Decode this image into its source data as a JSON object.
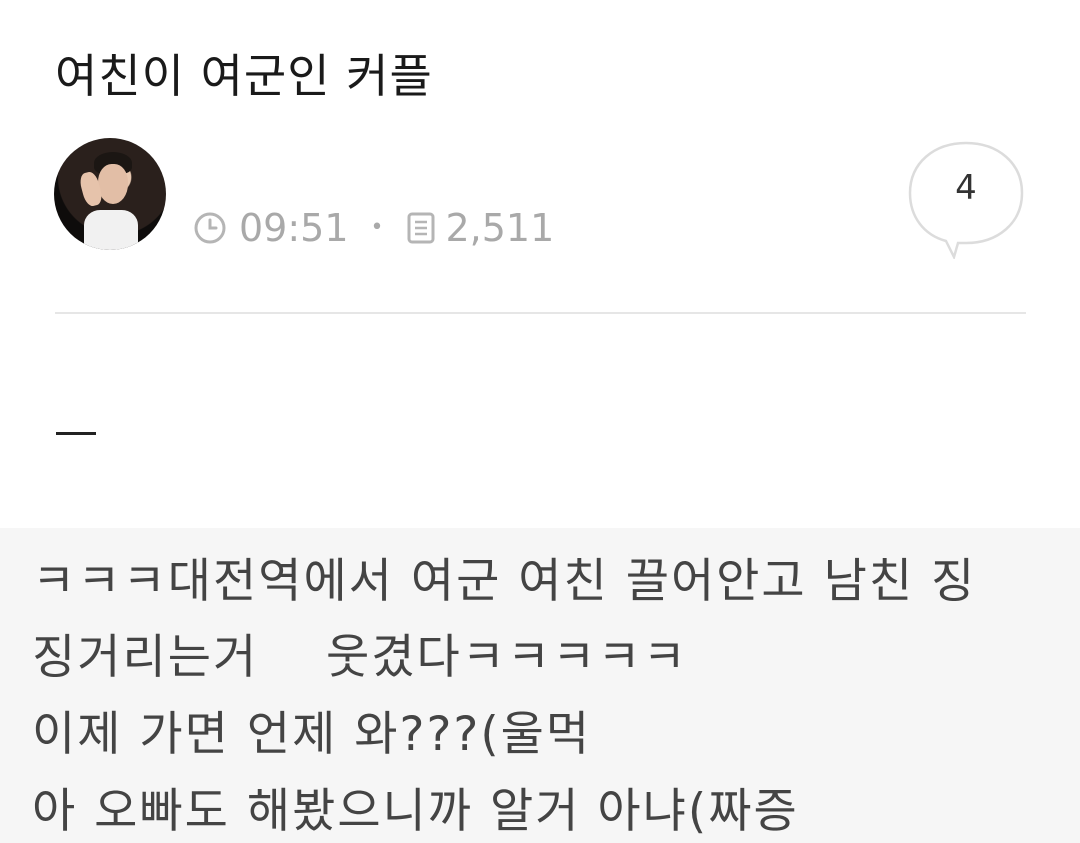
{
  "post": {
    "title": "여친이 여군인 커플",
    "time": "09:51",
    "views": "2,511",
    "comment_count": "4",
    "separator": "-",
    "body_lines": [
      "ㅋㅋㅋ대전역에서 여군 여친 끌어안고 남친 징",
      "징거리는거    웃겼다ㅋㅋㅋㅋㅋ",
      "이제 가면 언제 와???(울먹",
      "아 오빠도 해봤으니까 알거 아냐(짜증"
    ]
  },
  "icons": {
    "time": "clock-icon",
    "views": "document-icon",
    "comments": "speech-bubble-icon"
  },
  "colors": {
    "meta_text": "#a9a9a9",
    "content_background": "#f6f6f6"
  }
}
